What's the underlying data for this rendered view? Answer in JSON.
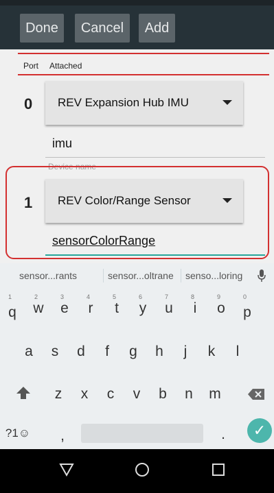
{
  "toolbar": {
    "done": "Done",
    "cancel": "Cancel",
    "add": "Add"
  },
  "table": {
    "port_header": "Port",
    "attached_header": "Attached"
  },
  "rows": [
    {
      "port": "0",
      "device": "REV Expansion Hub IMU",
      "name": "imu",
      "hint": "Device name"
    },
    {
      "port": "1",
      "device": "REV Color/Range Sensor",
      "name": "sensorColorRange"
    }
  ],
  "keyboard": {
    "suggestions": [
      "sensor...rants",
      "sensor...oltrane",
      "senso...loring"
    ],
    "row1": [
      "q",
      "w",
      "e",
      "r",
      "t",
      "y",
      "u",
      "i",
      "o",
      "p"
    ],
    "row1_digits": [
      "1",
      "2",
      "3",
      "4",
      "5",
      "6",
      "7",
      "8",
      "9",
      "0"
    ],
    "row2": [
      "a",
      "s",
      "d",
      "f",
      "g",
      "h",
      "j",
      "k",
      "l"
    ],
    "row3": [
      "z",
      "x",
      "c",
      "v",
      "b",
      "n",
      "m"
    ],
    "symbols": "?1☺",
    "comma": ",",
    "period": "."
  },
  "colors": {
    "toolbar_bg": "#263238",
    "button_bg": "#5b6469",
    "highlight": "#d32f2f",
    "enter": "#4db6ac",
    "cursor_line": "#26a69a"
  }
}
